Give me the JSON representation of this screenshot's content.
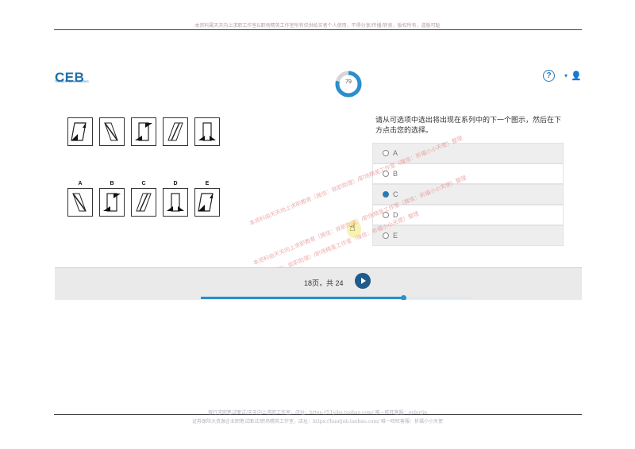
{
  "doc": {
    "header_text": "本资料属天天向上求职工作室&职场精英工作室所有仅供给买者个人使用，不得分享/传播/转卖，版权所有，盗版可耻",
    "footer_line1": "银行求职笔试面试/天天向上求职工作室，店址：https://51jobs.taobao.com/ 唯一旺旺客服：golerjin",
    "footer_line2": "证券保险大资源企业职笔试面试/职场精英工作室，店址：https://huntjob.taobao.com/ 唯一旺旺客服：祈福小小天使"
  },
  "app": {
    "logo": "CEB",
    "logo_sub": "THE BEST BENCHMARKS",
    "progress_pct": "79",
    "progress_value": 0.79,
    "help_label": "?",
    "help_caret": "▾",
    "user_icon": "user-icon"
  },
  "question": {
    "text": "请从可选项中选出将出现在系列中的下一个图示，然后在下方点击您的选择。",
    "series_count": 5,
    "answer_letters": [
      "A",
      "B",
      "C",
      "D",
      "E"
    ]
  },
  "options": [
    {
      "label": "A",
      "selected": false
    },
    {
      "label": "B",
      "selected": false
    },
    {
      "label": "C",
      "selected": true
    },
    {
      "label": "D",
      "selected": false
    },
    {
      "label": "E",
      "selected": false
    }
  ],
  "footer": {
    "page_text": "18页，共 24",
    "page_current": 18,
    "page_total": 24,
    "progress": 0.75
  },
  "watermarks": [
    "本资料由天天向上求职教育（微信：就职助理）/职场精英工作室（微信：祈福小小天使）整理",
    "本资料由天天向上求职教育（微信：就职助理）/职场精英工作室（微信：祈福小小天使）整理",
    "本资料由天天向上求职教育（微信：就职助理）/职场精英工作室（微信：祈福小小天使）整理"
  ],
  "colors": {
    "accent": "#2a7ab8",
    "next_button": "#1f5b8c",
    "watermark": "#e06a6a"
  }
}
